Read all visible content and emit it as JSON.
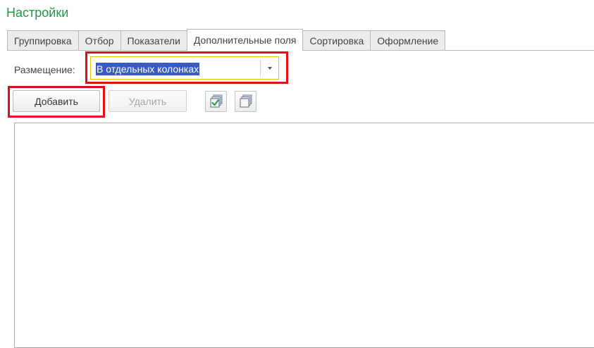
{
  "window": {
    "title": "Настройки"
  },
  "tabs": [
    {
      "label": "Группировка",
      "active": false
    },
    {
      "label": "Отбор",
      "active": false
    },
    {
      "label": "Показатели",
      "active": false
    },
    {
      "label": "Дополнительные поля",
      "active": true
    },
    {
      "label": "Сортировка",
      "active": false
    },
    {
      "label": "Оформление",
      "active": false
    }
  ],
  "placement": {
    "label": "Размещение:",
    "value": "В отдельных колонках"
  },
  "toolbar": {
    "add_label": "Добавить",
    "delete_label": "Удалить",
    "check_all_icon": "check-all-icon",
    "uncheck_all_icon": "uncheck-all-icon"
  },
  "colors": {
    "title": "#1a9b3f",
    "highlight": "#e0101e",
    "selection": "#3a5bc4",
    "focus_border": "#e8c300"
  }
}
